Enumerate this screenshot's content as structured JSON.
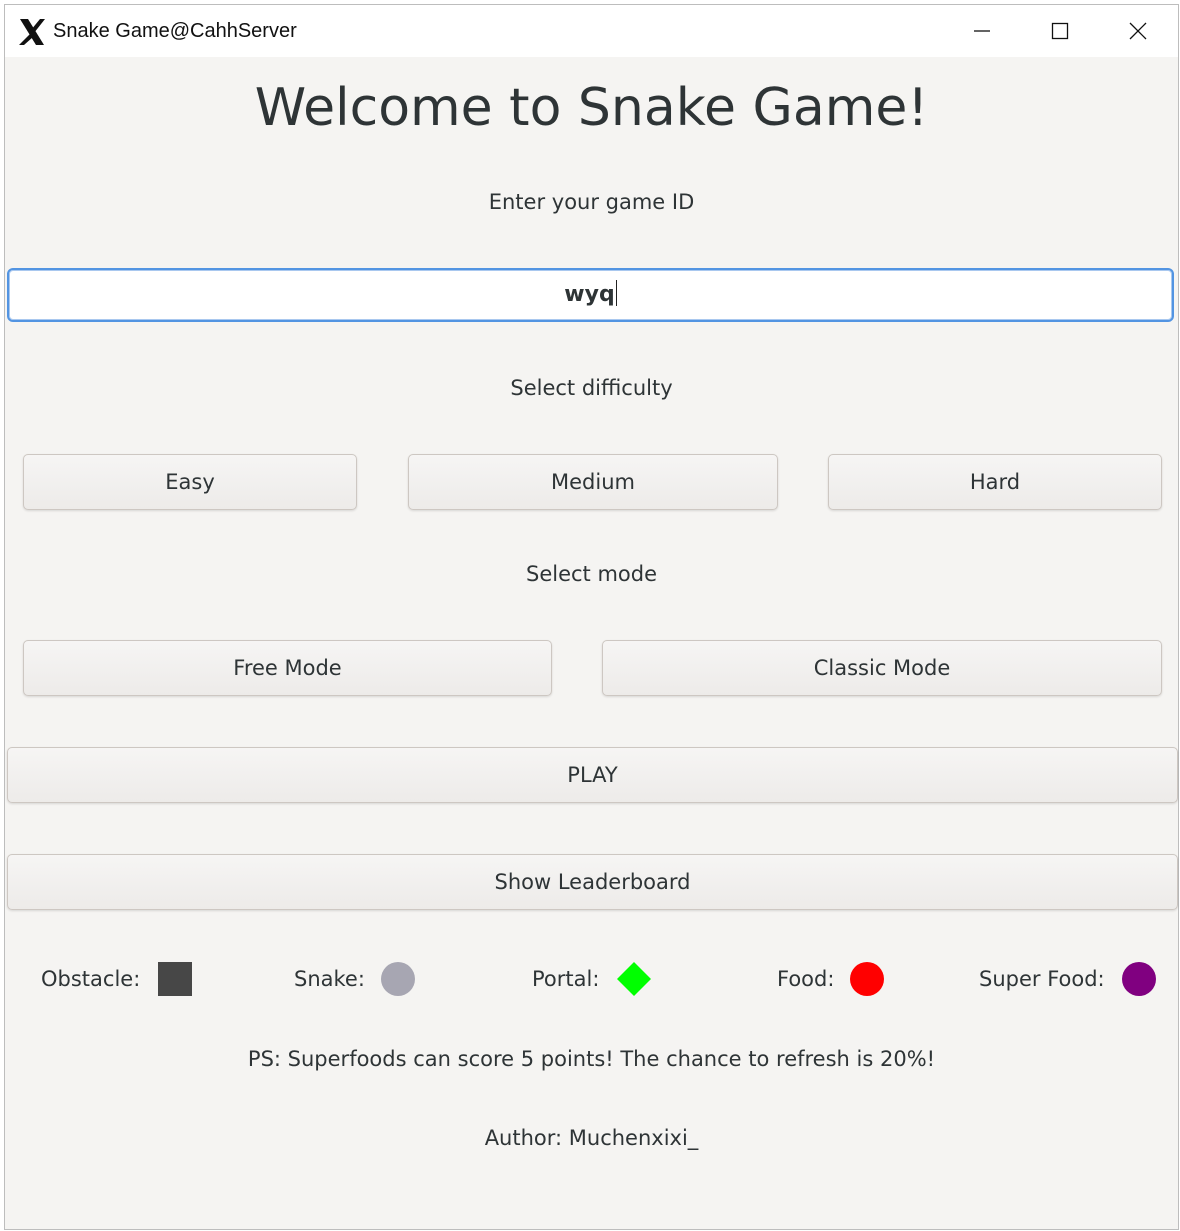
{
  "window": {
    "title": "Snake Game@CahhServer"
  },
  "main": {
    "heading": "Welcome to Snake Game!",
    "id_prompt": "Enter your game ID",
    "id_value": "wyq",
    "difficulty_prompt": "Select difficulty",
    "difficulty_options": [
      "Easy",
      "Medium",
      "Hard"
    ],
    "mode_prompt": "Select mode",
    "mode_options": [
      "Free Mode",
      "Classic Mode"
    ],
    "play_label": "PLAY",
    "leaderboard_label": "Show Leaderboard"
  },
  "legend": {
    "obstacle": {
      "label": "Obstacle:",
      "color": "#474747"
    },
    "snake": {
      "label": "Snake:",
      "color": "#a7a6b2"
    },
    "portal": {
      "label": "Portal:",
      "color": "#00ff00"
    },
    "food": {
      "label": "Food:",
      "color": "#ff0000"
    },
    "superfood": {
      "label": "Super Food:",
      "color": "#800080"
    }
  },
  "footer": {
    "ps_note": "PS: Superfoods can score 5 points! The chance to refresh is 20%!",
    "author": "Author: Muchenxixi_"
  }
}
